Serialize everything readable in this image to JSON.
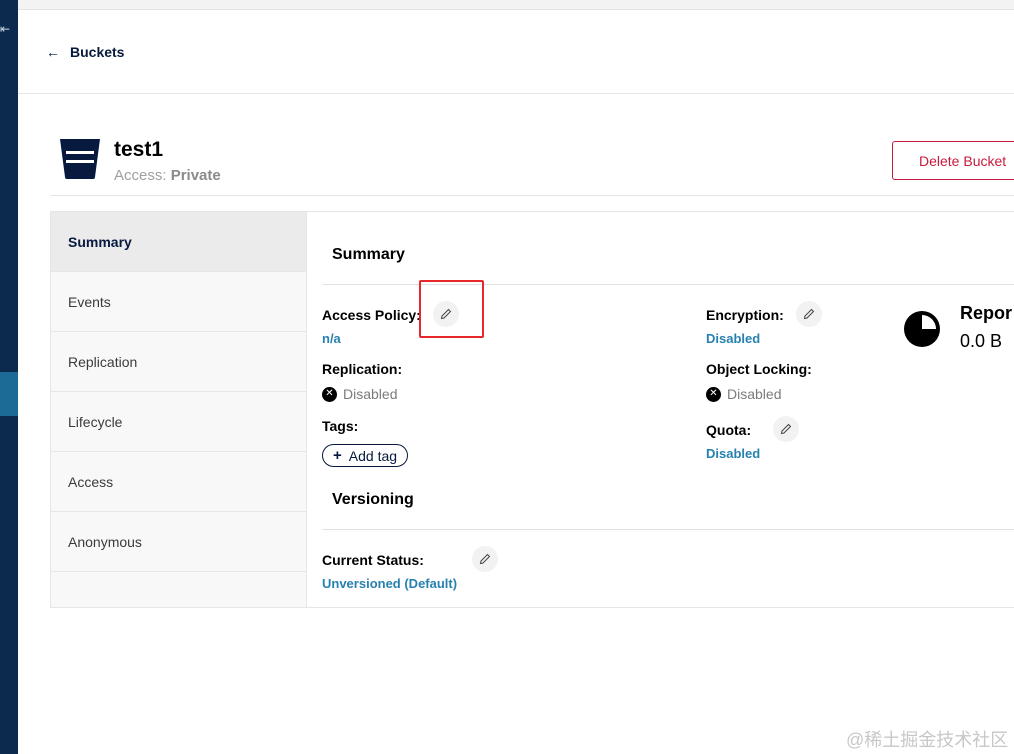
{
  "nav": {
    "collapse_glyph": "⇤"
  },
  "header": {
    "back_label": "Buckets"
  },
  "bucket": {
    "name": "test1",
    "access_prefix": "Access: ",
    "access_value": "Private",
    "delete_label": "Delete Bucket"
  },
  "tabs": [
    {
      "label": "Summary",
      "selected": true
    },
    {
      "label": "Events",
      "selected": false
    },
    {
      "label": "Replication",
      "selected": false
    },
    {
      "label": "Lifecycle",
      "selected": false
    },
    {
      "label": "Access",
      "selected": false
    },
    {
      "label": "Anonymous",
      "selected": false
    }
  ],
  "summary": {
    "title": "Summary",
    "access_policy_label": "Access Policy:",
    "access_policy_value": "n/a",
    "replication_label": "Replication:",
    "replication_value": "Disabled",
    "tags_label": "Tags:",
    "add_tag_label": "Add tag",
    "encryption_label": "Encryption:",
    "encryption_value": "Disabled",
    "object_locking_label": "Object Locking:",
    "object_locking_value": "Disabled",
    "quota_label": "Quota:",
    "quota_value": "Disabled"
  },
  "report": {
    "title": "Repor",
    "size": "0.0 B"
  },
  "versioning": {
    "title": "Versioning",
    "current_status_label": "Current Status:",
    "current_status_value": "Unversioned (Default)"
  },
  "watermark": "@稀土掘金技术社区",
  "colors": {
    "nav_bg": "#0c2a4d",
    "nav_active": "#1c6a96",
    "link": "#2781b0",
    "danger": "#c51c3e",
    "primary_dark": "#07193e",
    "highlight": "#e8272b"
  },
  "icons": {
    "back": "arrow-left-icon",
    "bucket": "bucket-icon",
    "edit": "pencil-icon",
    "disabled": "x-circle-icon",
    "add": "plus-icon",
    "report": "pie-chart-icon"
  }
}
